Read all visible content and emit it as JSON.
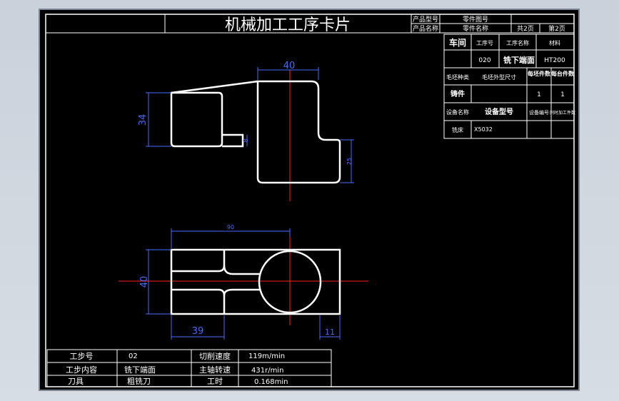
{
  "header": {
    "title": "机械加工工序卡片",
    "product_model_label": "产品型号",
    "product_name_label": "产品名称",
    "part_drawing_label": "零件图号",
    "part_name_label": "零件名称",
    "sheet_count": "共2页",
    "sheet_index": "第2页"
  },
  "info_table": {
    "workshop_label": "车间",
    "process_no_label": "工序号",
    "process_name_label": "工序名称",
    "material_label": "材料",
    "workshop_value": "",
    "process_no_value": "020",
    "process_name_value": "铣下端面",
    "material_value": "HT200",
    "blank_type_label": "毛坯种类",
    "blank_size_label": "毛坯外型尺寸",
    "blank_pieces_label": "每坯件数",
    "pieces_per_unit_label": "每台件数",
    "blank_type_value": "铸件",
    "blank_pieces_value": "1",
    "pieces_per_unit_value": "1",
    "equipment_name_label": "设备名称",
    "equipment_model_label": "设备型号",
    "equipment_no_label": "设备编号",
    "simultaneous_label": "同时加工件数",
    "equipment_name_value": "铣床",
    "equipment_model_value": "X5032"
  },
  "drawing": {
    "dims": {
      "top_width": "40",
      "left_height": "34",
      "slot_width": "8",
      "right_height": "25",
      "bottom_length": "90",
      "bottom_height": "40",
      "bottom_39": "39",
      "bottom_11": "11"
    }
  },
  "step_table": {
    "step_no_label": "工步号",
    "step_no_value": "02",
    "cut_speed_label": "切削速度",
    "cut_speed_value": "119m/min",
    "step_content_label": "工步内容",
    "step_content_value": "铣下端面",
    "spindle_speed_label": "主轴转速",
    "spindle_speed_value": "431r/min",
    "tool_label": "刀具",
    "tool_value": "粗铣刀",
    "time_label": "工时",
    "time_value": "0.168min"
  },
  "colors": {
    "background": "#000000",
    "lines": "#ffffff",
    "dimension": "#4a6bff",
    "centerline": "#ff2020"
  }
}
